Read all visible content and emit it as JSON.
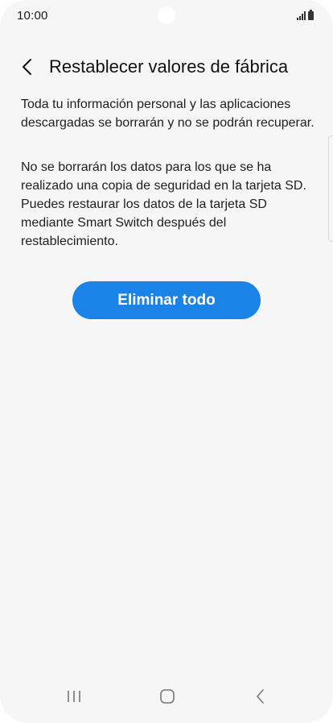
{
  "status_bar": {
    "time": "10:00",
    "icons": [
      "signal-icon",
      "battery-icon"
    ]
  },
  "header": {
    "back_icon": "chevron-left-icon",
    "title": "Restablecer valores de fábrica"
  },
  "content": {
    "paragraph_1": "Toda tu información personal y las aplicaciones descargadas se borrarán y no se podrán recuperar.",
    "paragraph_2": "No se borrarán los datos para los que se ha realizado una copia de seguridad en la tarjeta SD. Puedes restaurar los datos de la tarjeta SD mediante Smart Switch después del restablecimiento."
  },
  "action_button": {
    "label": "Eliminar todo"
  },
  "nav_bar": {
    "icons": [
      "recents-icon",
      "home-icon",
      "back-icon"
    ]
  },
  "colors": {
    "background": "#f6f6f6",
    "accent": "#1a83e8"
  }
}
